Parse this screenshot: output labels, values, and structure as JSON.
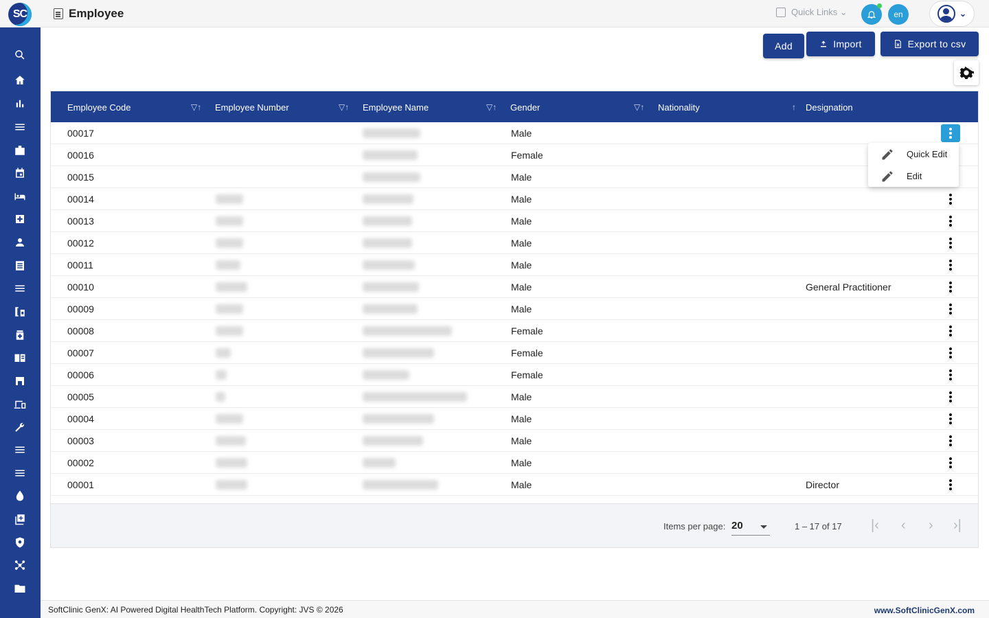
{
  "app": {
    "logo_text": "SC",
    "page_title": "Employee"
  },
  "topbar": {
    "quick_links": "Quick Links ⌄",
    "lang": "en"
  },
  "actions": {
    "add": "Add",
    "import": "Import",
    "export": "Export to csv"
  },
  "table": {
    "columns": [
      "Employee Code",
      "Employee Number",
      "Employee Name",
      "Gender",
      "Nationality",
      "Designation"
    ],
    "rows": [
      {
        "code": "00017",
        "gender": "Male",
        "designation": ""
      },
      {
        "code": "00016",
        "gender": "Female",
        "designation": ""
      },
      {
        "code": "00015",
        "gender": "Male",
        "designation": ""
      },
      {
        "code": "00014",
        "gender": "Male",
        "designation": ""
      },
      {
        "code": "00013",
        "gender": "Male",
        "designation": ""
      },
      {
        "code": "00012",
        "gender": "Male",
        "designation": ""
      },
      {
        "code": "00011",
        "gender": "Male",
        "designation": ""
      },
      {
        "code": "00010",
        "gender": "Male",
        "designation": "General Practitioner"
      },
      {
        "code": "00009",
        "gender": "Male",
        "designation": ""
      },
      {
        "code": "00008",
        "gender": "Female",
        "designation": ""
      },
      {
        "code": "00007",
        "gender": "Female",
        "designation": ""
      },
      {
        "code": "00006",
        "gender": "Female",
        "designation": ""
      },
      {
        "code": "00005",
        "gender": "Male",
        "designation": ""
      },
      {
        "code": "00004",
        "gender": "Male",
        "designation": ""
      },
      {
        "code": "00003",
        "gender": "Male",
        "designation": ""
      },
      {
        "code": "00002",
        "gender": "Male",
        "designation": ""
      },
      {
        "code": "00001",
        "gender": "Male",
        "designation": "Director"
      }
    ]
  },
  "context_menu": {
    "quick_edit": "Quick Edit",
    "edit": "Edit"
  },
  "paginator": {
    "items_per_page_label": "Items per page:",
    "items_per_page": "20",
    "range": "1 – 17 of 17"
  },
  "footer": {
    "copyright": "SoftClinic GenX: AI Powered Digital HealthTech Platform. Copyright: JVS © 2026",
    "website": "www.SoftClinicGenX.com"
  },
  "colors": {
    "primary": "#1f3f8f",
    "accent": "#2a9ed8"
  },
  "sidebar_icons": [
    "search-icon",
    "home-icon",
    "bar-chart-icon",
    "menu-icon",
    "badge-icon",
    "calendar-icon",
    "bed-icon",
    "medical-plus-icon",
    "person-icon",
    "receipt-icon",
    "list-icon",
    "pharmacy-icon",
    "medicine-icon",
    "book-icon",
    "store-icon",
    "devices-icon",
    "wrench-icon",
    "list-icon-2",
    "list-icon-3",
    "drop-icon",
    "add-box-icon",
    "shield-icon",
    "hub-icon",
    "folder-icon"
  ]
}
